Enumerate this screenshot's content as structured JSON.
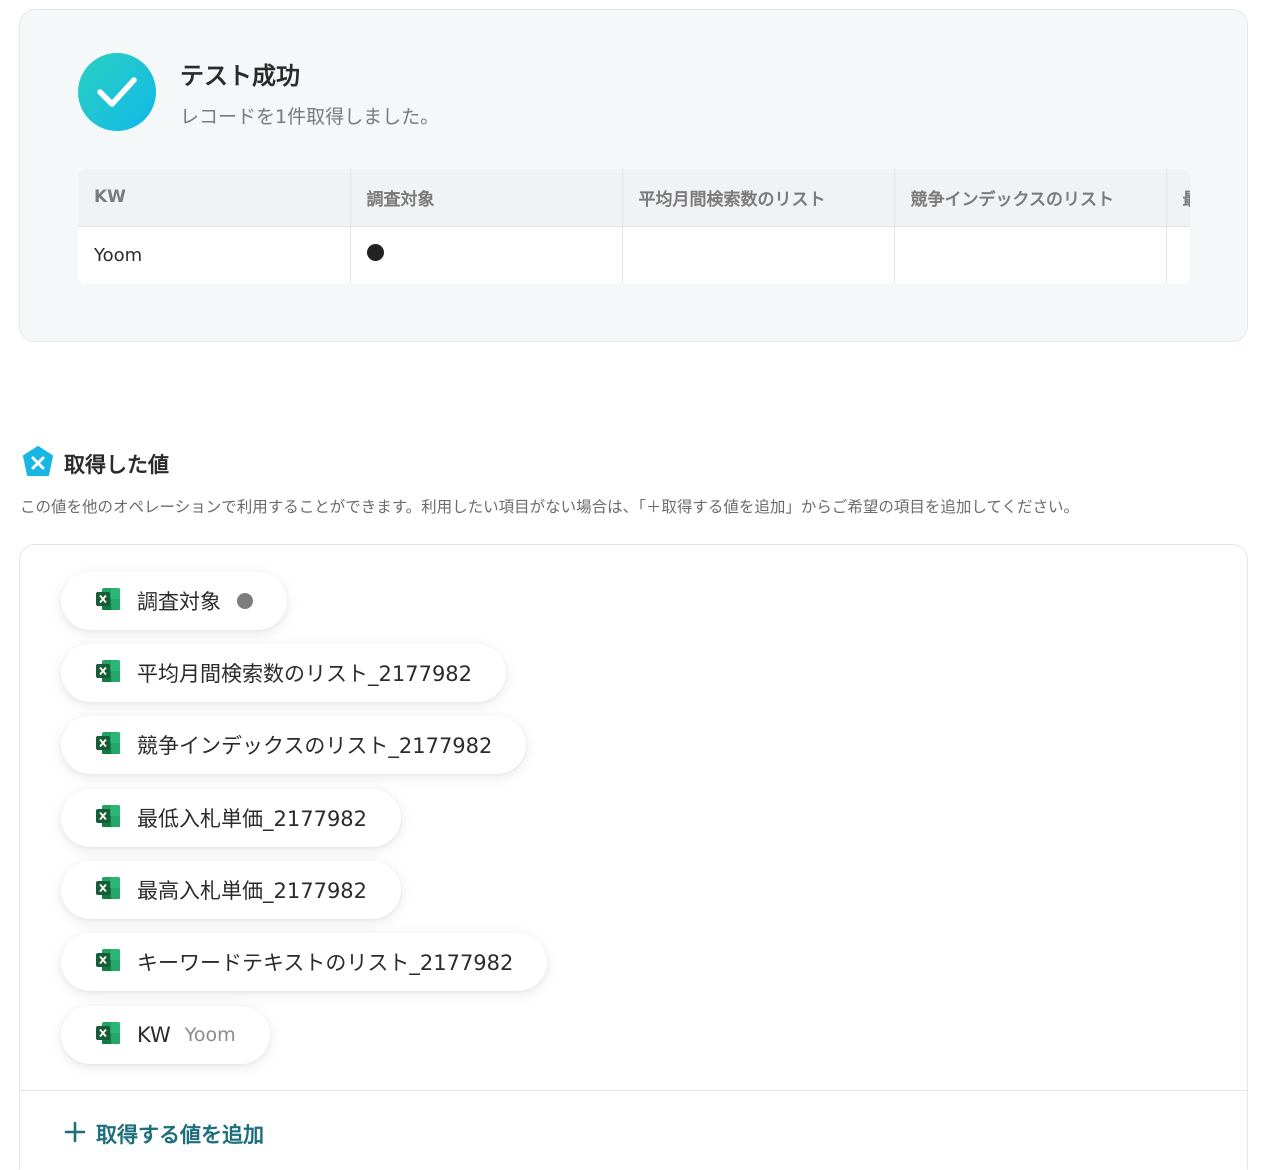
{
  "result": {
    "title": "テスト成功",
    "subtitle": "レコードを1件取得しました。",
    "icon": "check-icon",
    "columns": [
      "KW",
      "調査対象",
      "平均月間検索数のリスト",
      "競争インデックスのリスト",
      "最"
    ],
    "rows": [
      {
        "kw": "Yoom",
        "target": "●",
        "avg_search": "",
        "competition": "",
        "extra": ""
      }
    ]
  },
  "values_section": {
    "title": "取得した値",
    "description": "この値を他のオペレーションで利用することができます。利用したい項目がない場合は、「＋取得する値を追加」からご希望の項目を追加してください。",
    "icon": "yoom-variable-icon"
  },
  "chips": [
    {
      "label": "調査対象",
      "value": "●",
      "icon": "excel-icon"
    },
    {
      "label": "平均月間検索数のリスト_2177982",
      "value": "",
      "icon": "excel-icon"
    },
    {
      "label": "競争インデックスのリスト_2177982",
      "value": "",
      "icon": "excel-icon"
    },
    {
      "label": "最低入札単価_2177982",
      "value": "",
      "icon": "excel-icon"
    },
    {
      "label": "最高入札単価_2177982",
      "value": "",
      "icon": "excel-icon"
    },
    {
      "label": "キーワードテキストのリスト_2177982",
      "value": "",
      "icon": "excel-icon"
    },
    {
      "label": "KW",
      "value": "Yoom",
      "icon": "excel-icon"
    }
  ],
  "add_button": {
    "label": "取得する値を追加",
    "icon": "plus-icon"
  },
  "colors": {
    "accent": "#1d6f7e",
    "success_gradient_start": "#2bd1c2",
    "success_gradient_end": "#10b8e8",
    "excel_green": "#1e7145"
  }
}
